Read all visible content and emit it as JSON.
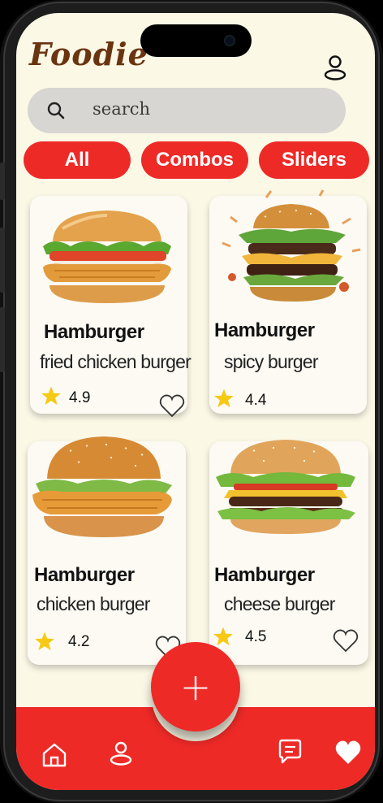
{
  "app": {
    "logo": "Foodie"
  },
  "search": {
    "placeholder": "search"
  },
  "categories": [
    {
      "label": "All"
    },
    {
      "label": "Combos"
    },
    {
      "label": "Sliders"
    }
  ],
  "products": [
    {
      "title": "Hamburger",
      "subtitle": "fried chicken burger",
      "rating": "4.9",
      "image": "fried-chicken-burger"
    },
    {
      "title": "Hamburger",
      "subtitle": "spicy burger",
      "rating": "4.4",
      "image": "spicy-burger"
    },
    {
      "title": "Hamburger",
      "subtitle": "chicken burger",
      "rating": "4.2",
      "image": "chicken-burger"
    },
    {
      "title": "Hamburger",
      "subtitle": "cheese burger",
      "rating": "4.5",
      "image": "cheese-burger"
    }
  ],
  "fab": {
    "label": "+"
  },
  "bottom_nav": [
    {
      "icon": "home-icon"
    },
    {
      "icon": "user-icon"
    },
    {
      "icon": "chat-icon"
    },
    {
      "icon": "heart-icon"
    }
  ],
  "colors": {
    "accent": "#ee2a27",
    "background": "#fbf8e6",
    "logo": "#6b3410",
    "star": "#f6c915"
  }
}
